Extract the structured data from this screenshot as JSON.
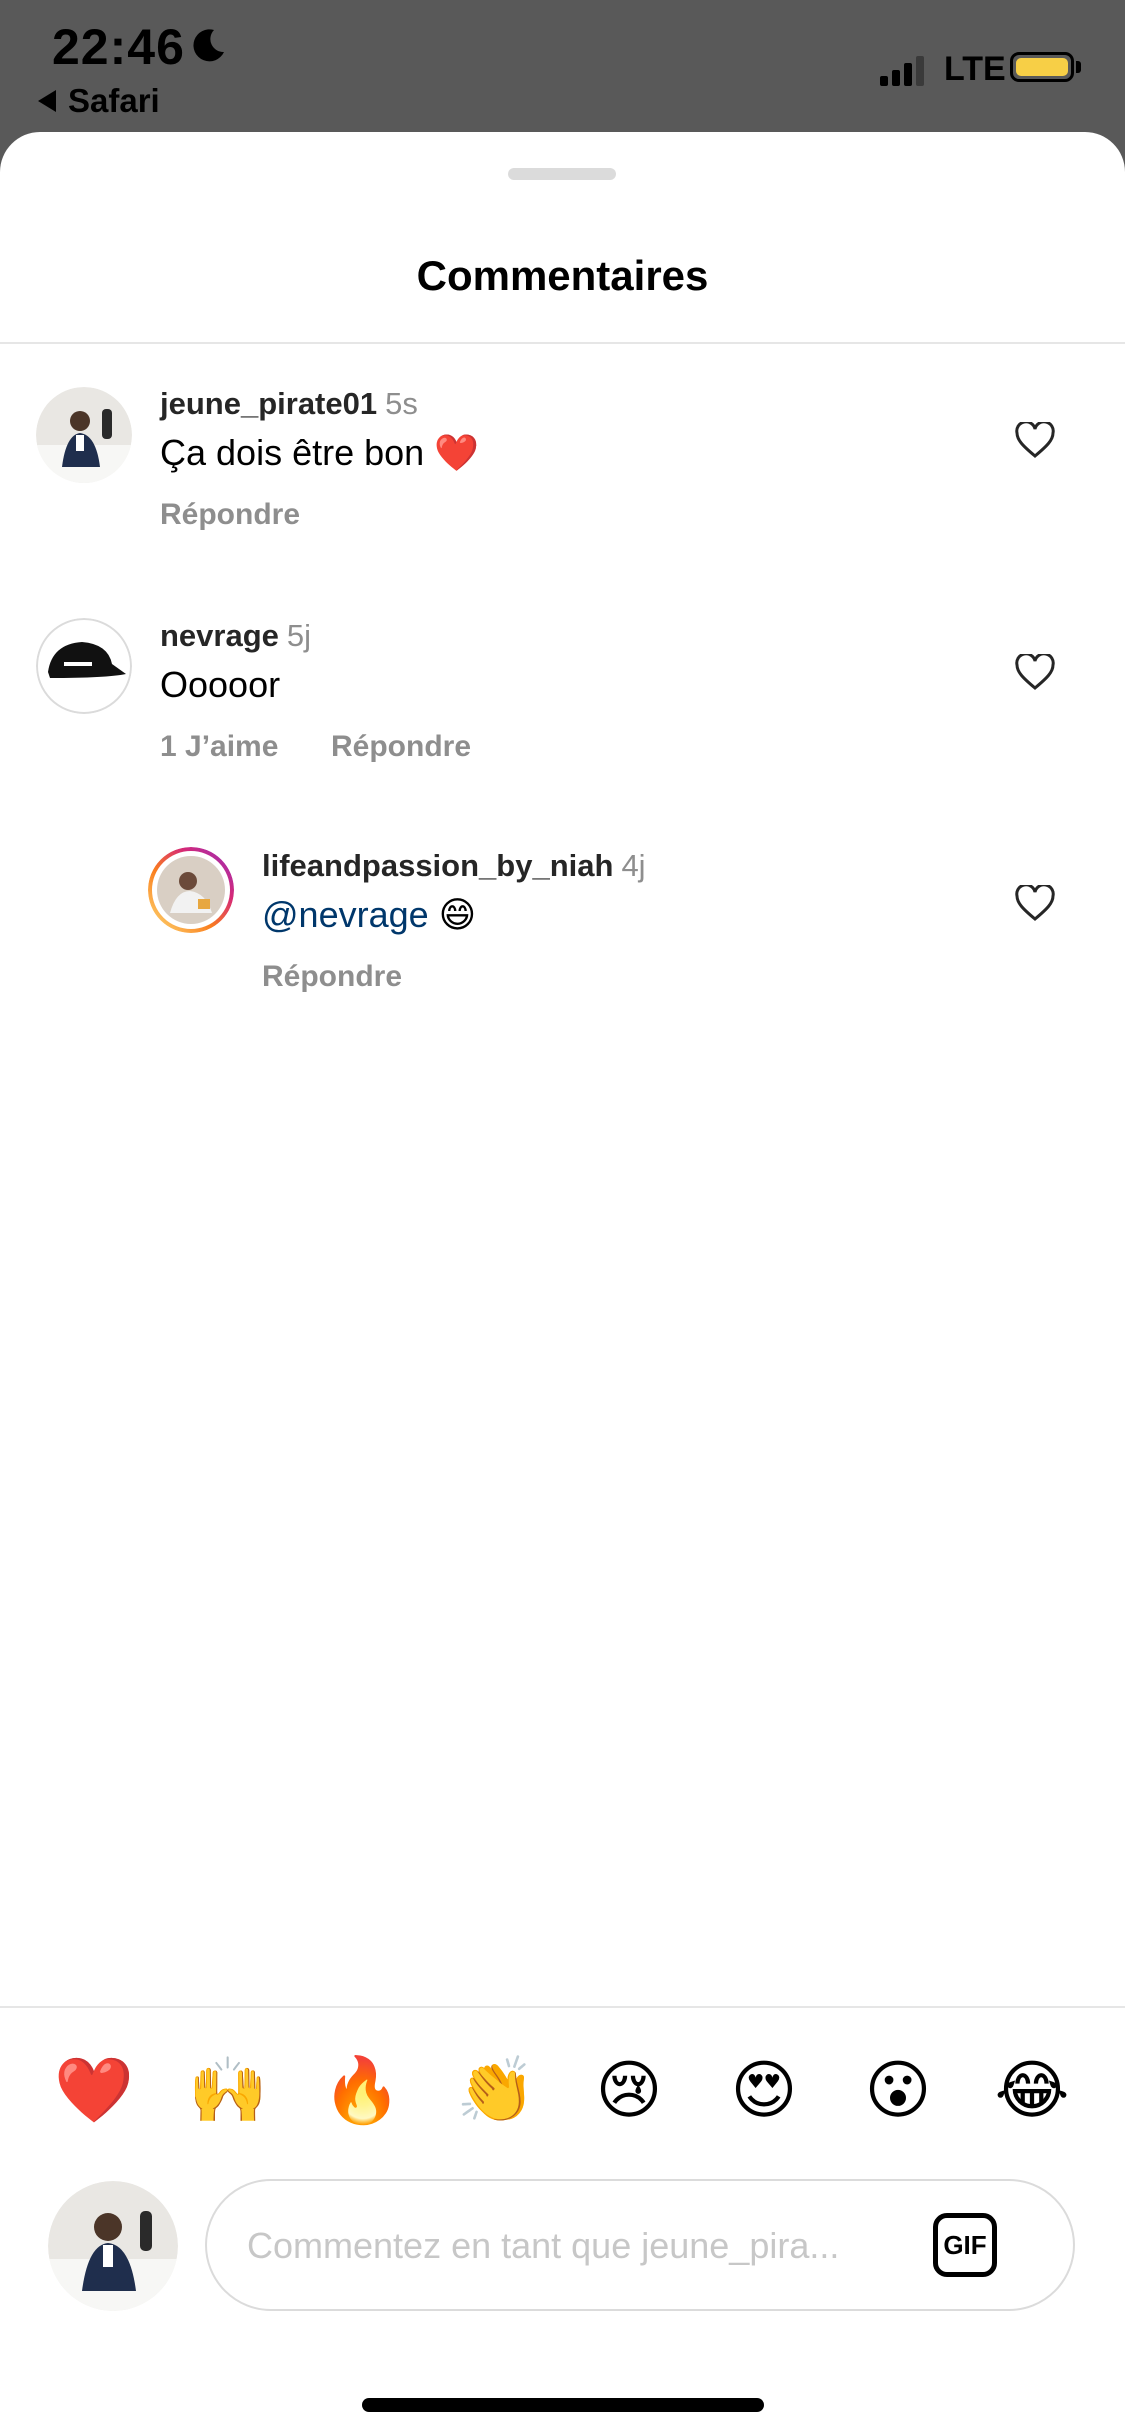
{
  "status_bar": {
    "time": "22:46",
    "back_app": "Safari",
    "network": "LTE",
    "battery_color": "#f7cf46"
  },
  "sheet": {
    "title": "Commentaires"
  },
  "comments": [
    {
      "username": "jeune_pirate01",
      "time": "5s",
      "text": "Ça dois être bon",
      "emoji": "❤️",
      "reply_label": "Répondre"
    },
    {
      "username": "nevrage",
      "time": "5j",
      "text": "Ooooor",
      "likes_label": "1 J’aime",
      "reply_label": "Répondre"
    },
    {
      "username": "lifeandpassion_by_niah",
      "time": "4j",
      "mention": "@nevrage",
      "emoji": "😄",
      "reply_label": "Répondre"
    }
  ],
  "emoji_bar": [
    "❤️",
    "🙌",
    "🔥",
    "👏",
    "😢",
    "😍",
    "😮",
    "😂"
  ],
  "composer": {
    "placeholder": "Commentez en tant que jeune_pira...",
    "gif_label": "GIF"
  },
  "colors": {
    "mention": "#00376b",
    "secondary_text": "#8e8e8e",
    "story_ring": "#d6249f"
  }
}
